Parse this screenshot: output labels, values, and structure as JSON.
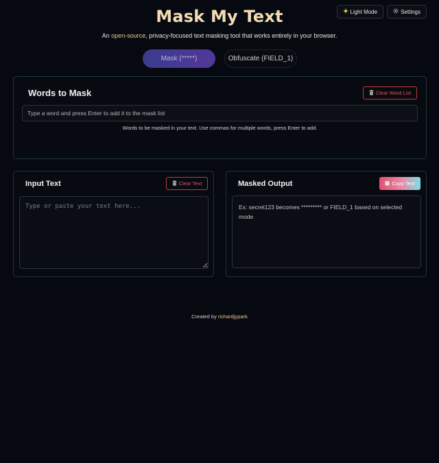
{
  "header": {
    "title": "Mask My Text",
    "subtitle_prefix": "An ",
    "subtitle_link": "open-source",
    "subtitle_suffix": ", privacy-focused text masking tool that works entirely in your browser.",
    "light_mode_label": "Light Mode",
    "light_mode_icon": "sun-icon",
    "settings_label": "Settings",
    "settings_icon": "gear-icon"
  },
  "modes": [
    {
      "label": "Mask (*****)",
      "active": true
    },
    {
      "label": "Obfuscate (FIELD_1)",
      "active": false
    }
  ],
  "words_panel": {
    "title": "Words to Mask",
    "clear_button": "Clear Word List",
    "input_placeholder": "Type a word and press Enter to add it to the mask list",
    "hint": "Words to be masked in your text. Use commas for multiple words, press Enter to add."
  },
  "input_panel": {
    "title": "Input Text",
    "clear_button": "Clear Text",
    "textarea_placeholder": "Type or paste your text here..."
  },
  "output_panel": {
    "title": "Masked Output",
    "copy_button": "Copy Text",
    "placeholder_text": "Ex: secret123 becomes ********* or FIELD_1 based on selected mode"
  },
  "footer": {
    "prefix": "Created by ",
    "author": "richardjypark"
  },
  "colors": {
    "background": "#060a10",
    "title": "#f4dcb3",
    "accent_link": "#f1c68e",
    "danger": "#e05555",
    "panel_border": "#1e3535"
  }
}
